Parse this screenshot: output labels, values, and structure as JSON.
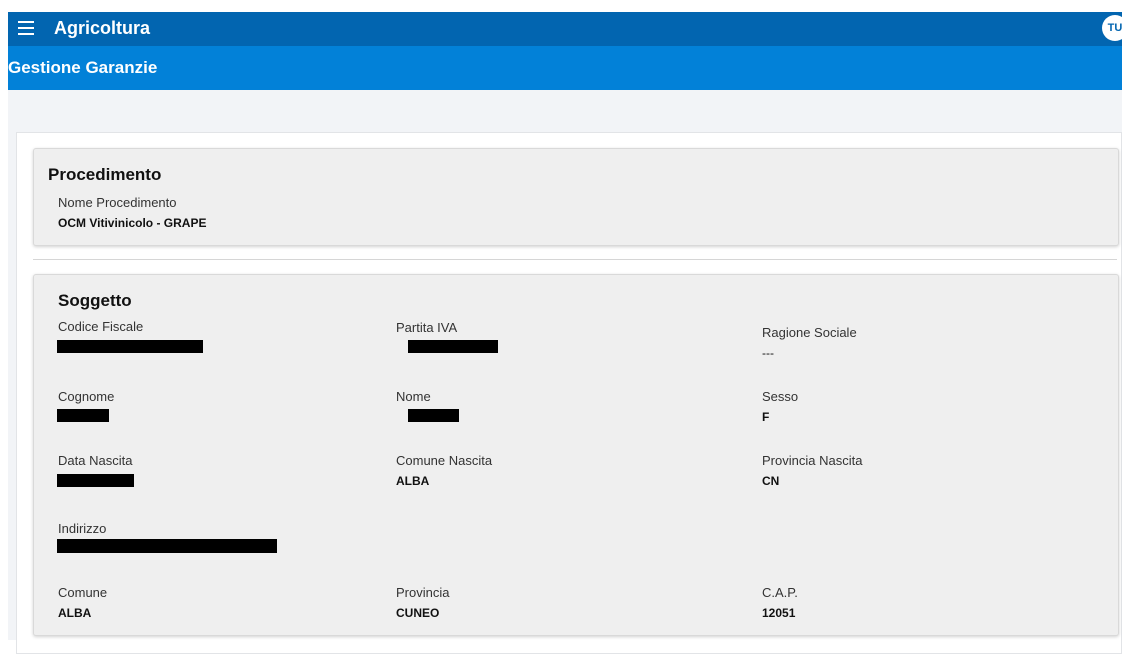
{
  "header": {
    "menu_icon": "hamburger-menu-icon",
    "app_title": "Agricoltura",
    "avatar_initials": "TU",
    "colors": {
      "topbar": "#0265b0",
      "subbar": "#0281d8"
    }
  },
  "page": {
    "title": "Gestione Garanzie"
  },
  "procedimento": {
    "title": "Procedimento",
    "nome_label": "Nome Procedimento",
    "nome_value": "OCM Vitivinicolo - GRAPE"
  },
  "soggetto": {
    "title": "Soggetto",
    "codice_fiscale_label": "Codice Fiscale",
    "partita_iva_label": "Partita IVA",
    "ragione_sociale_label": "Ragione Sociale",
    "ragione_sociale_value": "---",
    "cognome_label": "Cognome",
    "nome_label": "Nome",
    "sesso_label": "Sesso",
    "sesso_value": "F",
    "data_nascita_label": "Data Nascita",
    "comune_nascita_label": "Comune Nascita",
    "comune_nascita_value": "ALBA",
    "provincia_nascita_label": "Provincia Nascita",
    "provincia_nascita_value": "CN",
    "indirizzo_label": "Indirizzo",
    "comune_label": "Comune",
    "comune_value": "ALBA",
    "provincia_label": "Provincia",
    "provincia_value": "CUNEO",
    "cap_label": "C.A.P.",
    "cap_value": "12051"
  }
}
